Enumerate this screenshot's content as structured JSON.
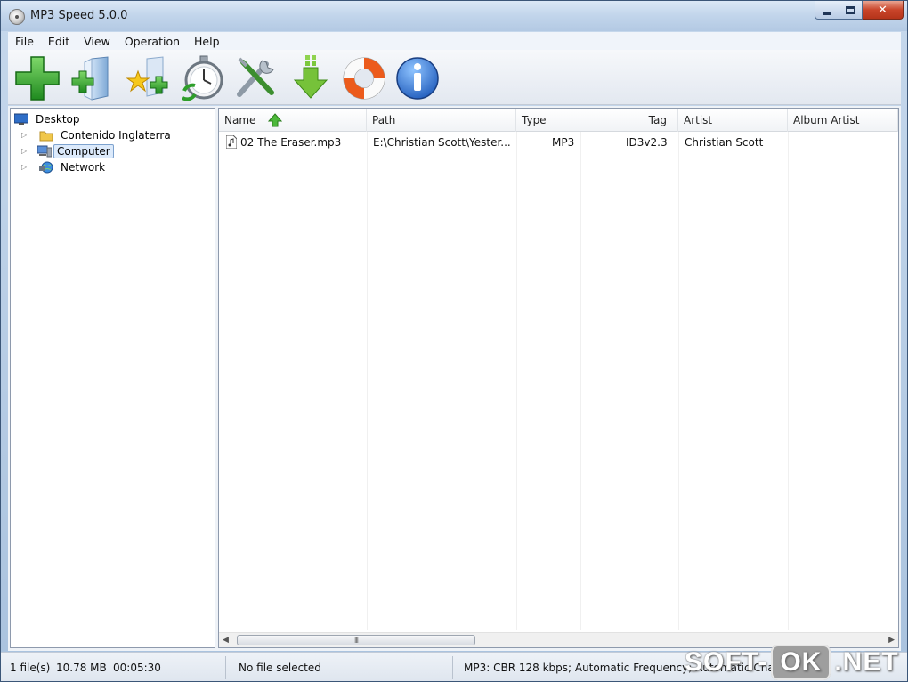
{
  "window": {
    "title": "MP3 Speed 5.0.0"
  },
  "menu": [
    "File",
    "Edit",
    "View",
    "Operation",
    "Help"
  ],
  "toolbar": {
    "buttons": [
      {
        "name": "add-files-button",
        "icon": "plus-icon"
      },
      {
        "name": "add-folder-button",
        "icon": "folder-plus-icon"
      },
      {
        "name": "add-favorites-button",
        "icon": "star-plus-icon"
      },
      {
        "name": "change-speed-button",
        "icon": "stopwatch-icon"
      },
      {
        "name": "settings-button",
        "icon": "tools-icon"
      },
      {
        "name": "download-button",
        "icon": "download-arrow-icon"
      },
      {
        "name": "help-button",
        "icon": "lifebuoy-icon"
      },
      {
        "name": "about-button",
        "icon": "info-icon"
      }
    ]
  },
  "tree": {
    "items": [
      {
        "label": "Desktop",
        "icon": "desktop-icon"
      },
      {
        "label": "Contenido Inglaterra",
        "icon": "folder-icon"
      },
      {
        "label": "Computer",
        "icon": "computer-icon",
        "selected": true
      },
      {
        "label": "Network",
        "icon": "network-icon"
      }
    ]
  },
  "list": {
    "columns": [
      "Name",
      "Path",
      "Type",
      "Tag",
      "Artist",
      "Album Artist"
    ],
    "sort_column": "Name",
    "sort_direction": "ascending",
    "rows": [
      {
        "name": "02 The Eraser.mp3",
        "path": "E:\\Christian Scott\\Yester...",
        "type": "MP3",
        "tag": "ID3v2.3",
        "artist": "Christian Scott",
        "album_artist": ""
      }
    ]
  },
  "scrollbar": {
    "thumb_glyph": "III",
    "position": 0.0
  },
  "status": {
    "files": "1 file(s)",
    "size": "10.78 MB",
    "duration": "00:05:30",
    "selection": "No file selected",
    "format_info": "MP3:  CBR 128 kbps; Automatic Frequency; Automatic Channel"
  },
  "watermark": {
    "left": "SOFT-",
    "box": "OK",
    "right": ".NET"
  },
  "colors": {
    "accent": "#3a8ee6",
    "close": "#c9452a",
    "plus_green": "#2e9e2a"
  }
}
